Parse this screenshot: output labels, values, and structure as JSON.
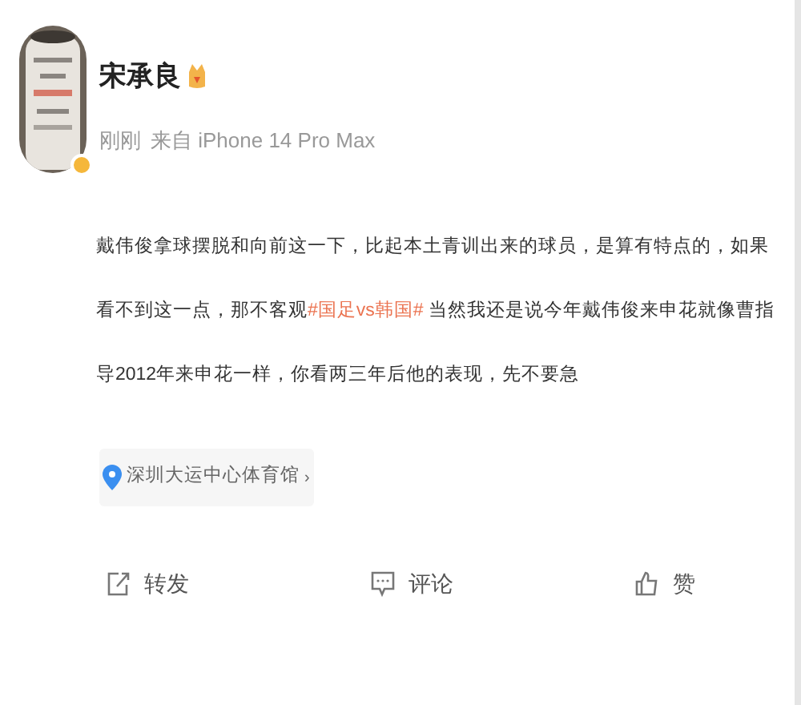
{
  "author": {
    "name": "宋承良",
    "verified": true,
    "crown_badge": true
  },
  "meta": {
    "time": "刚刚",
    "source": "来自 iPhone 14 Pro Max"
  },
  "post": {
    "parts": [
      {
        "kind": "text",
        "text": "戴伟俊拿球摆脱和向前这一下，比起本土青训出来的球员，是算有特点的，如果看不到这一点，那不客观"
      },
      {
        "kind": "hashtag",
        "text": "#国足vs韩国#"
      },
      {
        "kind": "text",
        "text": " 当然我还是说今年戴伟俊来申花就像曹指导2012年来申花一样，你看两三年后他的表现，先不要急"
      }
    ]
  },
  "location": {
    "text": "深圳大运中心体育馆",
    "arrow": "›"
  },
  "actions": [
    {
      "kind": "repost",
      "label": "转发"
    },
    {
      "kind": "comment",
      "label": "评论"
    },
    {
      "kind": "like",
      "label": "赞"
    }
  ]
}
